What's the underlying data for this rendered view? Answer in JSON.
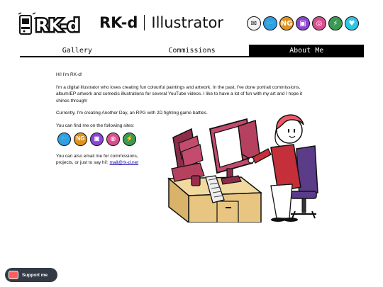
{
  "header": {
    "logo_text": "RK-d",
    "title_main": "RK-d",
    "title_sub": "Illustrator"
  },
  "social_icons": [
    {
      "name": "email-icon",
      "glyph": "✉",
      "color": "#f2f2f2"
    },
    {
      "name": "twitter-icon",
      "glyph": "🐦",
      "color": "#2ea0e8"
    },
    {
      "name": "newgrounds-icon",
      "glyph": "NG",
      "color": "#e0931c"
    },
    {
      "name": "twitch-icon",
      "glyph": "▣",
      "color": "#8c45d6"
    },
    {
      "name": "instagram-icon",
      "glyph": "◎",
      "color": "#d84f8f"
    },
    {
      "name": "itchio-icon",
      "glyph": "⚡",
      "color": "#3b9a52"
    },
    {
      "name": "kofi-icon",
      "glyph": "♥",
      "color": "#2ec6e6"
    }
  ],
  "nav": {
    "tabs": [
      "Gallery",
      "Commissions",
      "About Me"
    ],
    "active": "About Me"
  },
  "about": {
    "greeting": "Hi! I'm RK-d!",
    "intro": "I'm a digital illustrator who loves creating fun colourful paintings and artwork. In the past, I've done portrait commissions, album/EP artwork and comedic illustrations for several YouTube videos. I like to have a lot of fun with my art and I hope it shines through!",
    "current": "Currently, I'm creating Another Day, an RPG with 2D fighting game battles.",
    "find_me": "You can find me on the following sites:",
    "email_text": "You can also email me for commissions, projects, or just to say hi!:",
    "email_link": "mail@rk-d.net"
  },
  "site_icons": [
    {
      "name": "twitter-icon",
      "glyph": "🐦",
      "color": "#2ea0e8"
    },
    {
      "name": "newgrounds-icon",
      "glyph": "NG",
      "color": "#e0931c"
    },
    {
      "name": "twitch-icon",
      "glyph": "▣",
      "color": "#8c45d6"
    },
    {
      "name": "instagram-icon",
      "glyph": "◎",
      "color": "#d84f8f"
    },
    {
      "name": "itchio-icon",
      "glyph": "⚡",
      "color": "#3b9a52"
    }
  ],
  "kofi": {
    "label": "Support me"
  }
}
